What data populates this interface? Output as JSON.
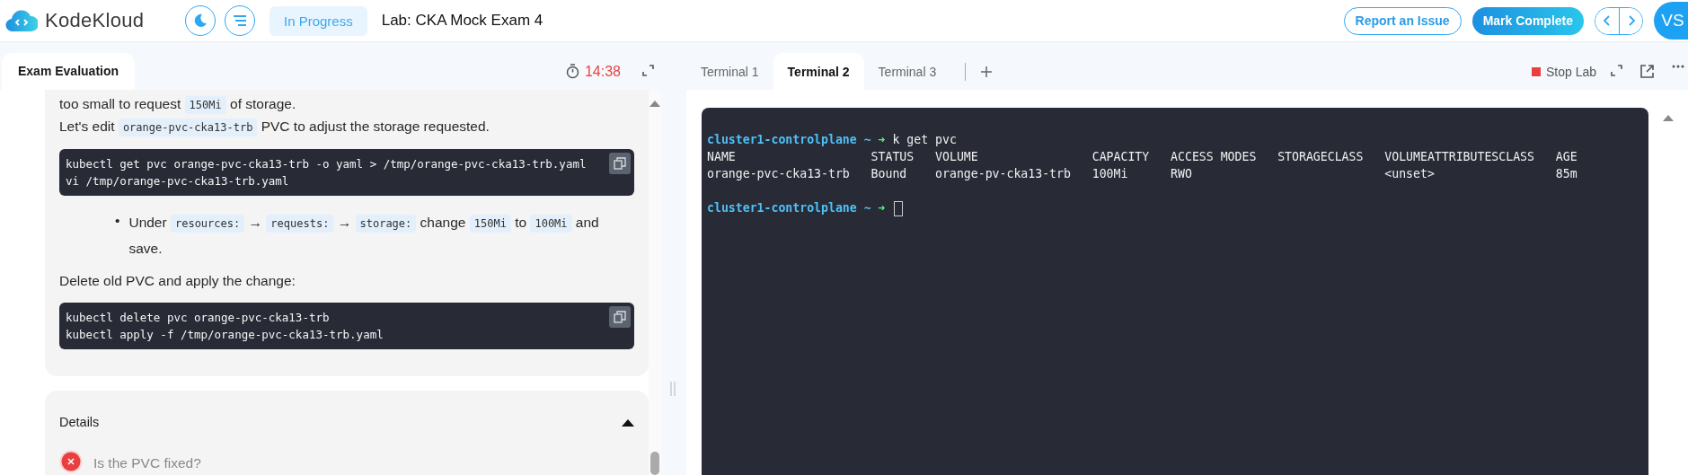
{
  "header": {
    "logo": "KodeKloud",
    "status": "In Progress",
    "title": "Lab: CKA Mock Exam 4",
    "report_button": "Report an Issue",
    "complete_button": "Mark Complete",
    "avatar": "VS"
  },
  "exam": {
    "tab": "Exam Evaluation",
    "timer": "14:38",
    "blocks": [
      {
        "kind": "para",
        "lines": [
          [
            {
              "kind": "text",
              "text": "too small to request "
            },
            {
              "kind": "code",
              "text": "150Mi"
            },
            {
              "kind": "text",
              "text": " of storage."
            }
          ],
          [
            {
              "kind": "text",
              "text": "Let's edit "
            },
            {
              "kind": "code",
              "text": "orange-pvc-cka13-trb"
            },
            {
              "kind": "text",
              "text": " PVC to adjust the storage requested."
            }
          ]
        ]
      },
      {
        "kind": "code",
        "lines": [
          "kubectl get pvc orange-pvc-cka13-trb -o yaml > /tmp/orange-pvc-cka13-trb.yaml",
          "vi /tmp/orange-pvc-cka13-trb.yaml"
        ]
      },
      {
        "kind": "bullet",
        "marker": "•",
        "lines": [
          [
            {
              "kind": "text",
              "text": "Under "
            },
            {
              "kind": "code",
              "text": "resources:"
            },
            {
              "kind": "text",
              "text": " → "
            },
            {
              "kind": "code",
              "text": "requests:"
            },
            {
              "kind": "text",
              "text": " → "
            },
            {
              "kind": "code",
              "text": "storage:"
            },
            {
              "kind": "text",
              "text": " change "
            },
            {
              "kind": "code",
              "text": "150Mi"
            },
            {
              "kind": "text",
              "text": " to "
            },
            {
              "kind": "code",
              "text": "100Mi"
            },
            {
              "kind": "text",
              "text": " and save."
            }
          ]
        ]
      },
      {
        "kind": "para",
        "lines": [
          [
            {
              "kind": "text",
              "text": "Delete old PVC and apply the change:"
            }
          ]
        ]
      },
      {
        "kind": "code",
        "lines": [
          "kubectl delete pvc orange-pvc-cka13-trb",
          "kubectl apply -f /tmp/orange-pvc-cka13-trb.yaml"
        ]
      }
    ],
    "details": {
      "title": "Details",
      "expanded": true,
      "checks": [
        {
          "text": "Is the PVC fixed?",
          "passed": false
        }
      ]
    }
  },
  "terminal": {
    "tabs": [
      {
        "label": "Terminal 1",
        "selected": false
      },
      {
        "label": "Terminal 2",
        "selected": true
      },
      {
        "label": "Terminal 3",
        "selected": false
      }
    ],
    "stop_button": "Stop Lab",
    "lines": [
      {
        "kind": "prompt",
        "host": "cluster1-controlplane ~ ➜",
        "command": " k get pvc"
      },
      {
        "kind": "output",
        "text": "NAME                   STATUS   VOLUME                CAPACITY   ACCESS MODES   STORAGECLASS   VOLUMEATTRIBUTESCLASS   AGE"
      },
      {
        "kind": "output",
        "text": "orange-pvc-cka13-trb   Bound    orange-pv-cka13-trb   100Mi      RWO                           <unset>                 85m"
      },
      {
        "kind": "blank"
      },
      {
        "kind": "prompt",
        "host": "cluster1-controlplane ~ ➜",
        "cursor": true
      }
    ]
  }
}
